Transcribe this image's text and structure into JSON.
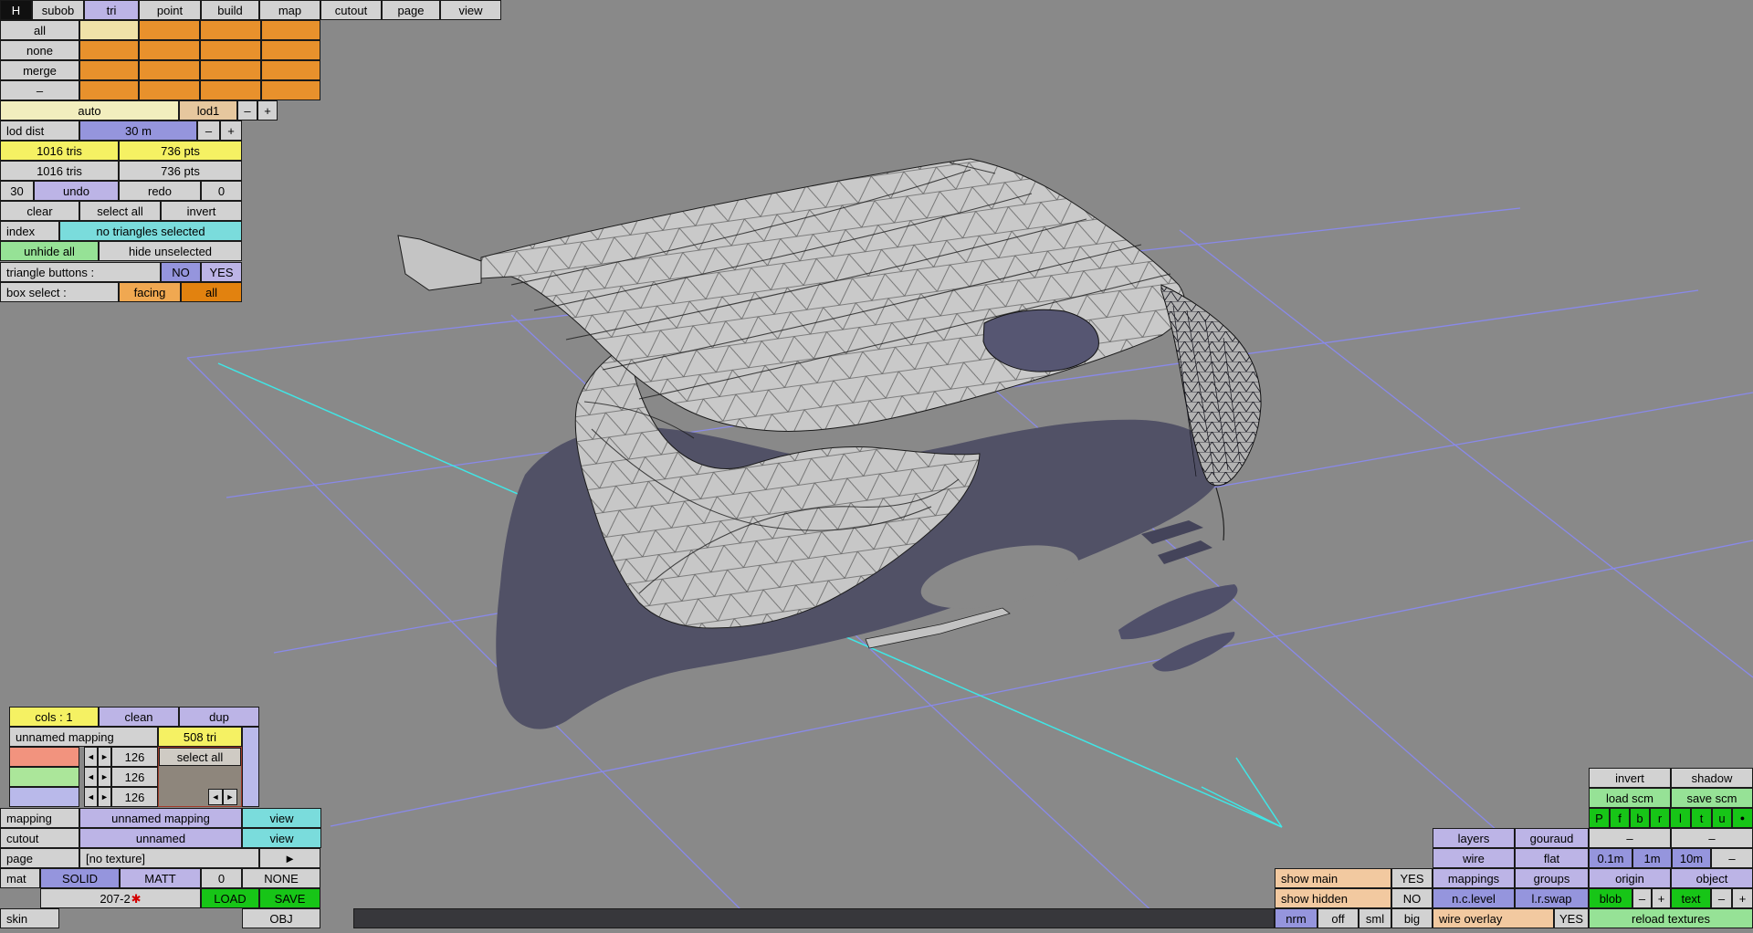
{
  "palette": {
    "viewport_bg": "#898989",
    "mesh_fill": "#c9c9c9",
    "shadow": "#515166",
    "grid_blue": "#8a8af0",
    "axis_cyan": "#40e6e6",
    "orange": "#e8912c",
    "yellow": "#f5f163",
    "lavender": "#bcb4e6",
    "periwinkle": "#9595dd",
    "cyan": "#7adcdc",
    "green_bright": "#17c517",
    "green_light": "#96e296",
    "peach": "#f2c9a0"
  },
  "menubar": {
    "h": "H",
    "tabs": [
      "subob",
      "tri",
      "point",
      "build",
      "map",
      "cutout",
      "page",
      "view"
    ],
    "active_tab": "tri"
  },
  "subob": {
    "row_labels": [
      "all",
      "none",
      "merge",
      "–"
    ],
    "auto": "auto",
    "lod1": "lod1",
    "minus": "–",
    "plus": "+"
  },
  "left": {
    "lod_dist": "lod dist",
    "lod_value": "30 m",
    "minus": "–",
    "plus": "+",
    "tris_a": "1016 tris",
    "pts_a": "736 pts",
    "tris_b": "1016 tris",
    "pts_b": "736 pts",
    "undo_count": "30",
    "undo": "undo",
    "redo": "redo",
    "redo_count": "0",
    "clear": "clear",
    "select_all": "select all",
    "invert": "invert",
    "index": "index",
    "index_status": "no triangles selected",
    "unhide_all": "unhide all",
    "hide_unselected": "hide unselected",
    "tri_buttons_label": "triangle buttons :",
    "no": "NO",
    "yes": "YES",
    "box_select_label": "box select :",
    "facing": "facing",
    "all": "all"
  },
  "map_panel": {
    "cols": "cols : 1",
    "clean": "clean",
    "dup": "dup",
    "name": "unnamed mapping",
    "tris": "508 tri",
    "ch1": "126",
    "ch2": "126",
    "ch3": "126",
    "select_all": "select all",
    "arrow_left": "◄",
    "arrow_right": "►",
    "mapping_label": "mapping",
    "mapping_value": "unnamed mapping",
    "mapping_view": "view",
    "cutout_label": "cutout",
    "cutout_value": "unnamed",
    "cutout_view": "view",
    "page_label": "page",
    "page_value": "[no texture]",
    "page_next": "►",
    "mat": "mat",
    "solid": "SOLID",
    "matt": "MATT",
    "zero": "0",
    "none": "NONE",
    "file_name": "207-2",
    "file_star": "✱",
    "load": "LOAD",
    "save": "SAVE",
    "skin": "skin",
    "obj": "OBJ"
  },
  "right": {
    "invert": "invert",
    "shadow": "shadow",
    "load_scm": "load scm",
    "save_scm": "save scm",
    "flags": [
      "P",
      "f",
      "b",
      "r",
      "l",
      "t",
      "u",
      "●"
    ],
    "layers": "layers",
    "gouraud": "gouraud",
    "dash1": "–",
    "dash2": "–",
    "wire": "wire",
    "flat": "flat",
    "m01": "0.1m",
    "m1": "1m",
    "m10": "10m",
    "dash3": "–",
    "show_main": "show main",
    "yes1": "YES",
    "mappings": "mappings",
    "groups": "groups",
    "origin": "origin",
    "object": "object",
    "show_hidden": "show hidden",
    "no1": "NO",
    "nclevel": "n.c.level",
    "lrswap": "l.r.swap",
    "blob": "blob",
    "blob_minus": "–",
    "blob_plus": "+",
    "text": "text",
    "text_minus": "–",
    "text_plus": "+",
    "nrm": "nrm",
    "off": "off",
    "sml": "sml",
    "big": "big",
    "wire_overlay": "wire overlay",
    "yes2": "YES",
    "reload": "reload textures"
  }
}
